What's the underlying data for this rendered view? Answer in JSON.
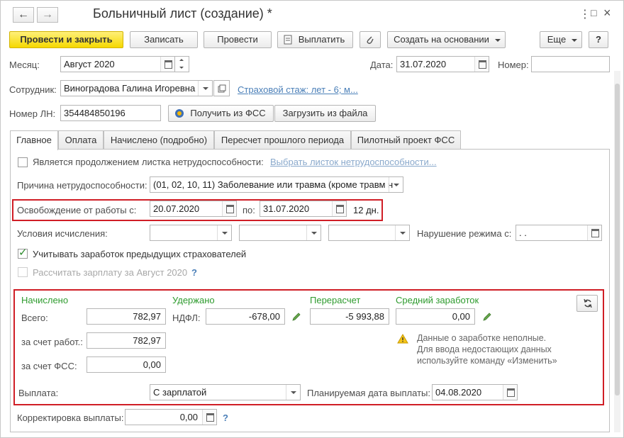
{
  "window": {
    "title": "Больничный лист (создание) *",
    "back_icon": "←",
    "forward_icon": "→",
    "menu_icon": "⋮",
    "maximize_icon": "□",
    "close_icon": "×"
  },
  "toolbar": {
    "post_and_close": "Провести и закрыть",
    "save": "Записать",
    "post": "Провести",
    "pay": "Выплатить",
    "create_based": "Создать на основании",
    "more": "Еще",
    "help": "?"
  },
  "header": {
    "month_label": "Месяц:",
    "month_value": "Август 2020",
    "date_label": "Дата:",
    "date_value": "31.07.2020",
    "number_label": "Номер:",
    "number_value": "",
    "employee_label": "Сотрудник:",
    "employee_value": "Виноградова Галина Игоревна",
    "insurance_link": "Страховой стаж: лет - 6; м...",
    "ln_label": "Номер ЛН:",
    "ln_value": "354484850196",
    "get_from_fss": "Получить из ФСС",
    "load_from_file": "Загрузить из файла"
  },
  "tabs": [
    {
      "label": "Главное"
    },
    {
      "label": "Оплата"
    },
    {
      "label": "Начислено (подробно)"
    },
    {
      "label": "Пересчет прошлого периода"
    },
    {
      "label": "Пилотный проект ФСС"
    }
  ],
  "main": {
    "continuation_label": "Является продолжением листка нетрудоспособности:",
    "choose_sheet_link": "Выбрать листок нетрудоспособности...",
    "reason_label": "Причина нетрудоспособности:",
    "reason_value": "(01, 02, 10, 11) Заболевание или травма (кроме травм н",
    "release_label": "Освобождение от работы с:",
    "release_from": "20.07.2020",
    "release_to_label": "по:",
    "release_to": "31.07.2020",
    "release_days": "12 дн.",
    "conditions_label": "Условия исчисления:",
    "violation_label": "Нарушение режима с:",
    "violation_value": " .  .",
    "prev_insurers_label": "Учитывать заработок предыдущих страхователей",
    "calc_salary_label": "Рассчитать зарплату за Август 2020",
    "calc_salary_help": "?"
  },
  "summary": {
    "accrued_header": "Начислено",
    "withheld_header": "Удержано",
    "recalc_header": "Перерасчет",
    "avg_header": "Средний заработок",
    "total_label": "Всего:",
    "total_value": "782,97",
    "ndfl_label": "НДФЛ:",
    "ndfl_value": "-678,00",
    "recalc_value": "-5 993,88",
    "avg_value": "0,00",
    "employer_label": "за счет работ.:",
    "employer_value": "782,97",
    "fss_label": "за счет ФСС:",
    "fss_value": "0,00",
    "warning_text_1": "Данные о заработке неполные.",
    "warning_text_2": "Для ввода недостающих данных",
    "warning_text_3": "используйте команду «Изменить»",
    "payout_label": "Выплата:",
    "payout_value": "С зарплатой",
    "planned_date_label": "Планируемая дата выплаты:",
    "planned_date_value": "04.08.2020"
  },
  "correction": {
    "label": "Корректировка выплаты:",
    "value": "0,00",
    "help": "?"
  },
  "colors": {
    "accent_yellow": "#f5d800",
    "highlight_red": "#d01e26",
    "section_green": "#2e9b2e",
    "link_blue": "#4a7fb8"
  }
}
